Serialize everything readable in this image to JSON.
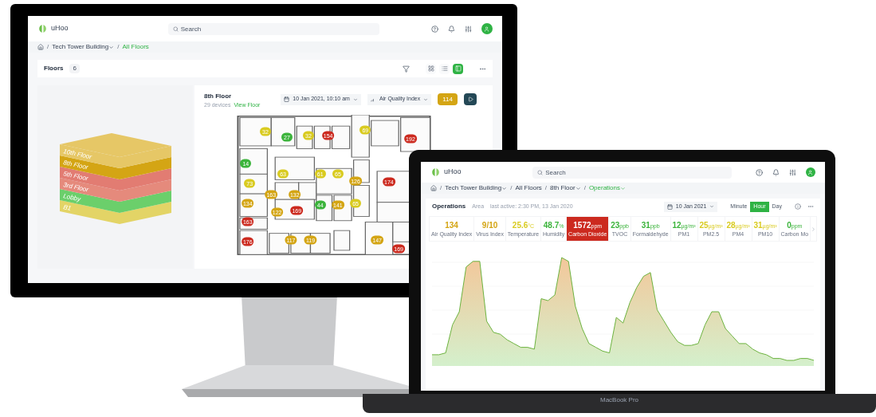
{
  "monitor": {
    "header": {
      "logo": "uHoo",
      "search": {
        "placeholder": "Search"
      }
    },
    "breadcrumb": {
      "separator": "/",
      "items": [
        {
          "label": "Tech Tower Building",
          "dropdown": true,
          "current": false
        },
        {
          "label": "All Floors",
          "dropdown": false,
          "current": true
        }
      ]
    },
    "floors_bar": {
      "title": "Floors",
      "count": "6",
      "views": [
        {
          "kind": "grid",
          "selected": false
        },
        {
          "kind": "list",
          "selected": false
        },
        {
          "kind": "map",
          "selected": true
        }
      ]
    },
    "floor_stack": [
      {
        "label": "10th Floor",
        "color": "#e6c766"
      },
      {
        "label": "8th Floor",
        "color": "#d4a514"
      },
      {
        "label": "5th Floor",
        "color": "#e27c72"
      },
      {
        "label": "3rd Floor",
        "color": "#e58a7c"
      },
      {
        "label": "Lobby",
        "color": "#6bcf6b"
      },
      {
        "label": "B1",
        "color": "#e3d466"
      }
    ],
    "floor": {
      "name": "8th Floor",
      "devices": "29 devices",
      "link": "View Floor",
      "date": "10 Jan 2021, 10:10 am",
      "metric": "Air Quality Index",
      "value": "114",
      "color": "#d4a514"
    },
    "markers": [
      {
        "value": "32",
        "color": "#d9cb20"
      },
      {
        "value": "27",
        "color": "#3cb43c"
      },
      {
        "value": "32",
        "color": "#d9cb20"
      },
      {
        "value": "154",
        "color": "#cc2a1f"
      },
      {
        "value": "69",
        "color": "#d9cb20"
      },
      {
        "value": "192",
        "color": "#cc2a1f"
      },
      {
        "value": "14",
        "color": "#3cb43c"
      },
      {
        "value": "73",
        "color": "#d9cb20"
      },
      {
        "value": "63",
        "color": "#d9cb20"
      },
      {
        "value": "61",
        "color": "#d9cb20"
      },
      {
        "value": "65",
        "color": "#d9cb20"
      },
      {
        "value": "126",
        "color": "#d4a514"
      },
      {
        "value": "174",
        "color": "#cc2a1f"
      },
      {
        "value": "134",
        "color": "#d4a514"
      },
      {
        "value": "163",
        "color": "#d4a514"
      },
      {
        "value": "122",
        "color": "#d4a514"
      },
      {
        "value": "132",
        "color": "#d4a514"
      },
      {
        "value": "169",
        "color": "#cc2a1f"
      },
      {
        "value": "44",
        "color": "#3cb43c"
      },
      {
        "value": "141",
        "color": "#d4a514"
      },
      {
        "value": "65",
        "color": "#d9cb20"
      },
      {
        "value": "163",
        "color": "#cc2a1f"
      },
      {
        "value": "176",
        "color": "#cc2a1f"
      },
      {
        "value": "117",
        "color": "#d4a514"
      },
      {
        "value": "119",
        "color": "#d4a514"
      },
      {
        "value": "147",
        "color": "#d4a514"
      },
      {
        "value": "169",
        "color": "#cc2a1f"
      }
    ]
  },
  "laptop": {
    "header": {
      "logo": "uHoo",
      "search": {
        "placeholder": "Search"
      }
    },
    "breadcrumb": {
      "separator": "/",
      "items": [
        {
          "label": "Tech Tower Building",
          "dropdown": true,
          "current": false
        },
        {
          "label": "All Floors",
          "dropdown": false,
          "current": false
        },
        {
          "label": "8th Floor",
          "dropdown": true,
          "current": false
        },
        {
          "label": "Operations",
          "dropdown": true,
          "current": true
        }
      ]
    },
    "room": {
      "title": "Operations",
      "type": "Area",
      "last_active": "last active: 2:30 PM, 13 Jan 2020",
      "date": "10 Jan 2021",
      "intervals": [
        {
          "label": "Minute",
          "selected": false
        },
        {
          "label": "Hour",
          "selected": true
        },
        {
          "label": "Day",
          "selected": false
        }
      ]
    },
    "metrics": [
      {
        "value": "134",
        "label": "Air Quality Index",
        "color": "#d4a514",
        "selected": false
      },
      {
        "value": "9/10",
        "label": "Virus Index",
        "color": "#d4a514",
        "selected": false
      },
      {
        "value": "25.6",
        "unit": "°C",
        "label": "Temperature",
        "color": "#d9cb20",
        "selected": false
      },
      {
        "value": "48.7",
        "unit": "%",
        "label": "Humidity",
        "color": "#3cb43c",
        "selected": false
      },
      {
        "value": "1572",
        "unit": "ppm",
        "label": "Carbon Dioxide",
        "color": "#cc2a1f",
        "selected": true
      },
      {
        "value": "23",
        "unit": "ppb",
        "label": "TVOC",
        "color": "#3cb43c",
        "selected": false
      },
      {
        "value": "31",
        "unit": "ppb",
        "label": "Formaldehyde",
        "color": "#3cb43c",
        "selected": false
      },
      {
        "value": "12",
        "unit": "µg/m³",
        "label": "PM1",
        "color": "#3cb43c",
        "selected": false
      },
      {
        "value": "25",
        "unit": "µg/m³",
        "label": "PM2.5",
        "color": "#d9cb20",
        "selected": false
      },
      {
        "value": "28",
        "unit": "µg/m³",
        "label": "PM4",
        "color": "#d9cb20",
        "selected": false
      },
      {
        "value": "31",
        "unit": "µg/m³",
        "label": "PM10",
        "color": "#d9cb20",
        "selected": false
      },
      {
        "value": "0",
        "unit": "ppm",
        "label": "Carbon Mo",
        "color": "#3cb43c",
        "selected": false
      }
    ],
    "label": "MacBook Pro"
  }
}
